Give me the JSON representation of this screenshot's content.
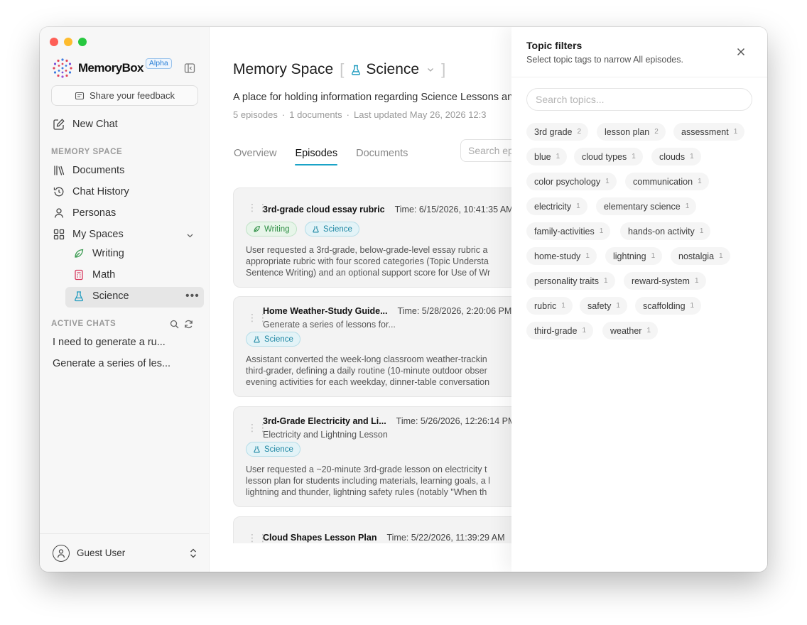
{
  "sidebar": {
    "brand_name": "MemoryBox",
    "brand_badge": "Alpha",
    "feedback_label": "Share your feedback",
    "new_chat_label": "New Chat",
    "memory_space_section": "MEMORY SPACE",
    "nav": {
      "documents": "Documents",
      "chat_history": "Chat History",
      "personas": "Personas",
      "my_spaces": "My Spaces"
    },
    "spaces": {
      "writing": "Writing",
      "math": "Math",
      "science": "Science"
    },
    "active_chats_section": "ACTIVE CHATS",
    "active_chats": {
      "chat1": "I need to generate a ru...",
      "chat2": "Generate a series of les..."
    },
    "user_name": "Guest User"
  },
  "main": {
    "title": "Memory Space",
    "space_name": "Science",
    "description": "A place for holding information regarding Science Lessons an",
    "meta": {
      "episodes": "5 episodes",
      "documents": "1 documents",
      "updated": "Last updated May 26, 2026 12:3"
    },
    "tabs": {
      "overview": "Overview",
      "episodes": "Episodes",
      "documents": "Documents"
    },
    "search_placeholder": "Search ep",
    "episodes": {
      "e1": {
        "title": "3rd-grade cloud essay rubric",
        "time": "Time: 6/15/2026, 10:41:35 AM",
        "tag1": "Writing",
        "tag2": "Science",
        "body1": "User requested a 3rd-grade, below-grade-level essay rubric a",
        "body2": "appropriate rubric with four scored categories (Topic Understa",
        "body3": "Sentence Writing) and an optional support score for Use of Wr"
      },
      "e2": {
        "title": "Home Weather-Study Guide...",
        "time": "Time: 5/28/2026, 2:20:06 PM",
        "subtitle": "Generate a series of lessons for...",
        "tag1": "Science",
        "body1": "Assistant converted the week-long classroom weather-trackin",
        "body2": "third-grader, defining a daily routine (10-minute outdoor obser",
        "body3": "evening activities for each weekday, dinner-table conversation"
      },
      "e3": {
        "title": "3rd-Grade Electricity and Li...",
        "time": "Time: 5/26/2026, 12:26:14 PM",
        "subtitle": "Electricity and Lightning Lesson",
        "tag1": "Science",
        "body1": "User requested a ~20-minute 3rd-grade lesson on electricity t",
        "body2": "lesson plan for students including materials, learning goals, a l",
        "body3": "lightning and thunder, lightning safety rules (notably \"When th"
      },
      "e4": {
        "title": "Cloud Shapes Lesson Plan",
        "time": "Time: 5/22/2026, 11:39:29 AM"
      }
    }
  },
  "topic_panel": {
    "title": "Topic filters",
    "subtitle": "Select topic tags to narrow All episodes.",
    "search_placeholder": "Search topics...",
    "topics": [
      {
        "label": "3rd grade",
        "count": "2"
      },
      {
        "label": "lesson plan",
        "count": "2"
      },
      {
        "label": "assessment",
        "count": "1"
      },
      {
        "label": "blue",
        "count": "1"
      },
      {
        "label": "cloud types",
        "count": "1"
      },
      {
        "label": "clouds",
        "count": "1"
      },
      {
        "label": "color psychology",
        "count": "1"
      },
      {
        "label": "communication",
        "count": "1"
      },
      {
        "label": "electricity",
        "count": "1"
      },
      {
        "label": "elementary science",
        "count": "1"
      },
      {
        "label": "family-activities",
        "count": "1"
      },
      {
        "label": "hands-on activity",
        "count": "1"
      },
      {
        "label": "home-study",
        "count": "1"
      },
      {
        "label": "lightning",
        "count": "1"
      },
      {
        "label": "nostalgia",
        "count": "1"
      },
      {
        "label": "personality traits",
        "count": "1"
      },
      {
        "label": "reward-system",
        "count": "1"
      },
      {
        "label": "rubric",
        "count": "1"
      },
      {
        "label": "safety",
        "count": "1"
      },
      {
        "label": "scaffolding",
        "count": "1"
      },
      {
        "label": "third-grade",
        "count": "1"
      },
      {
        "label": "weather",
        "count": "1"
      }
    ]
  },
  "colors": {
    "accent": "#1aa3c7",
    "writing_tag": "#2f8f45",
    "science_tag": "#1e87a3",
    "alpha_badge": "#2a7fd6"
  }
}
